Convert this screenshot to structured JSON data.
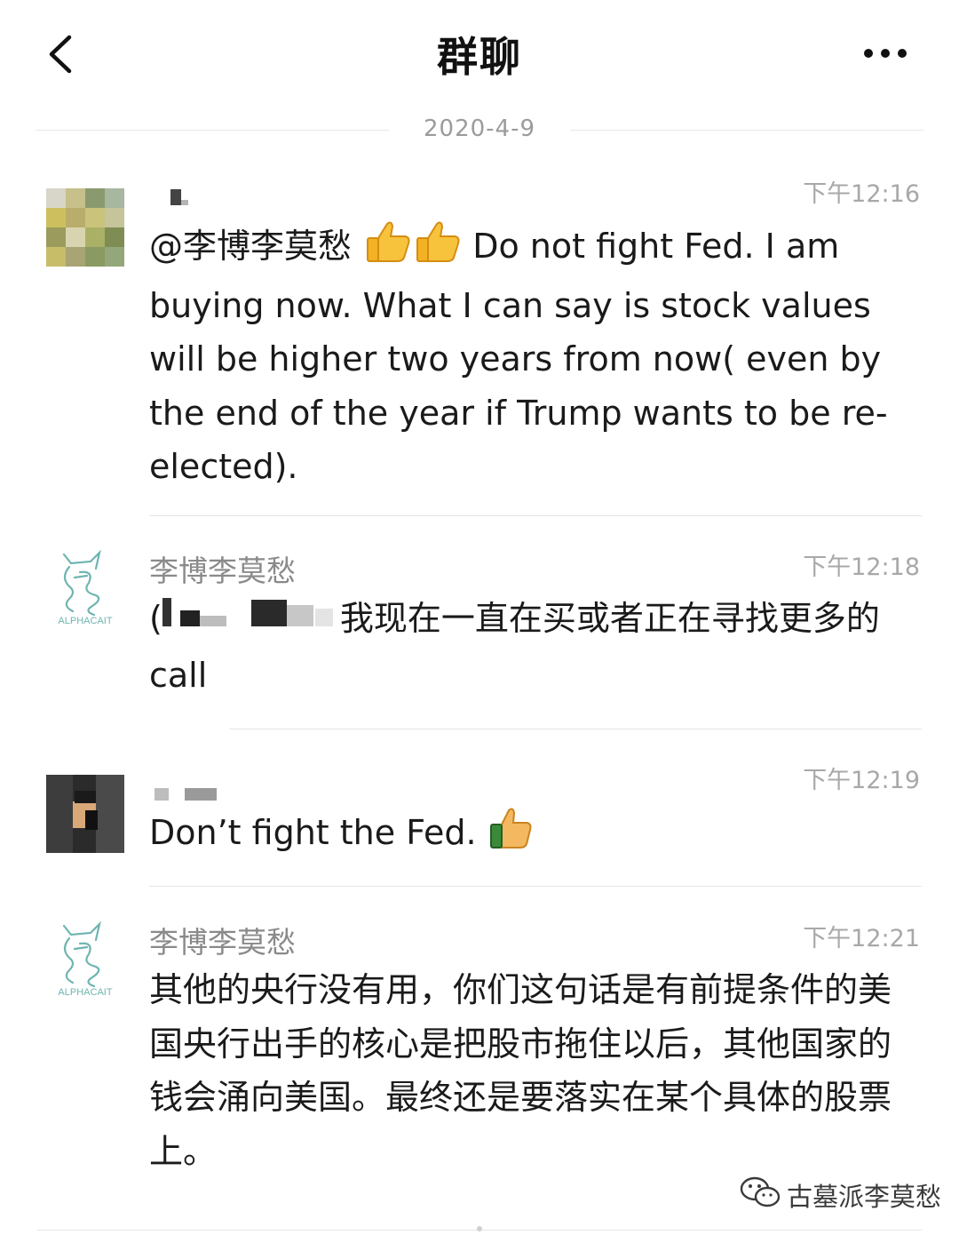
{
  "header": {
    "title": "群聊",
    "back_icon": "chevron-left-icon",
    "more_icon": "more-dots-icon"
  },
  "date_separator": "2020-4-9",
  "messages": [
    {
      "sender": "",
      "time": "下午12:16",
      "mention": "@李博李莫愁",
      "text": "Do not fight Fed. I am buying now. What I can say is stock values will be higher two years from now( even by the end of the year if Trump wants to be re-elected).",
      "icons": [
        "thumbs-up-icon",
        "thumbs-up-icon"
      ]
    },
    {
      "sender": "李博李莫愁",
      "time": "下午12:18",
      "text_prefix": "(",
      "text": "我现在一直在买或者正在寻找更多的call",
      "avatar_logo": "ALPHACAIT"
    },
    {
      "sender": "",
      "time": "下午12:19",
      "text": "Don’t fight the Fed.",
      "icons": [
        "thumbs-up-icon"
      ]
    },
    {
      "sender": "李博李莫愁",
      "time": "下午12:21",
      "text": "其他的央行没有用，你们这句话是有前提条件的美国央行出手的核心是把股市拖住以后，其他国家的钱会涌向美国。最终还是要落实在某个具体的股票上。",
      "avatar_logo": "ALPHACAIT"
    }
  ],
  "watermark": "古墓派李莫愁",
  "colors": {
    "background": "#ffffff",
    "meta_text": "#a8a8a8",
    "divider": "#e5e5e5",
    "logo_teal": "#6fb5b0"
  }
}
